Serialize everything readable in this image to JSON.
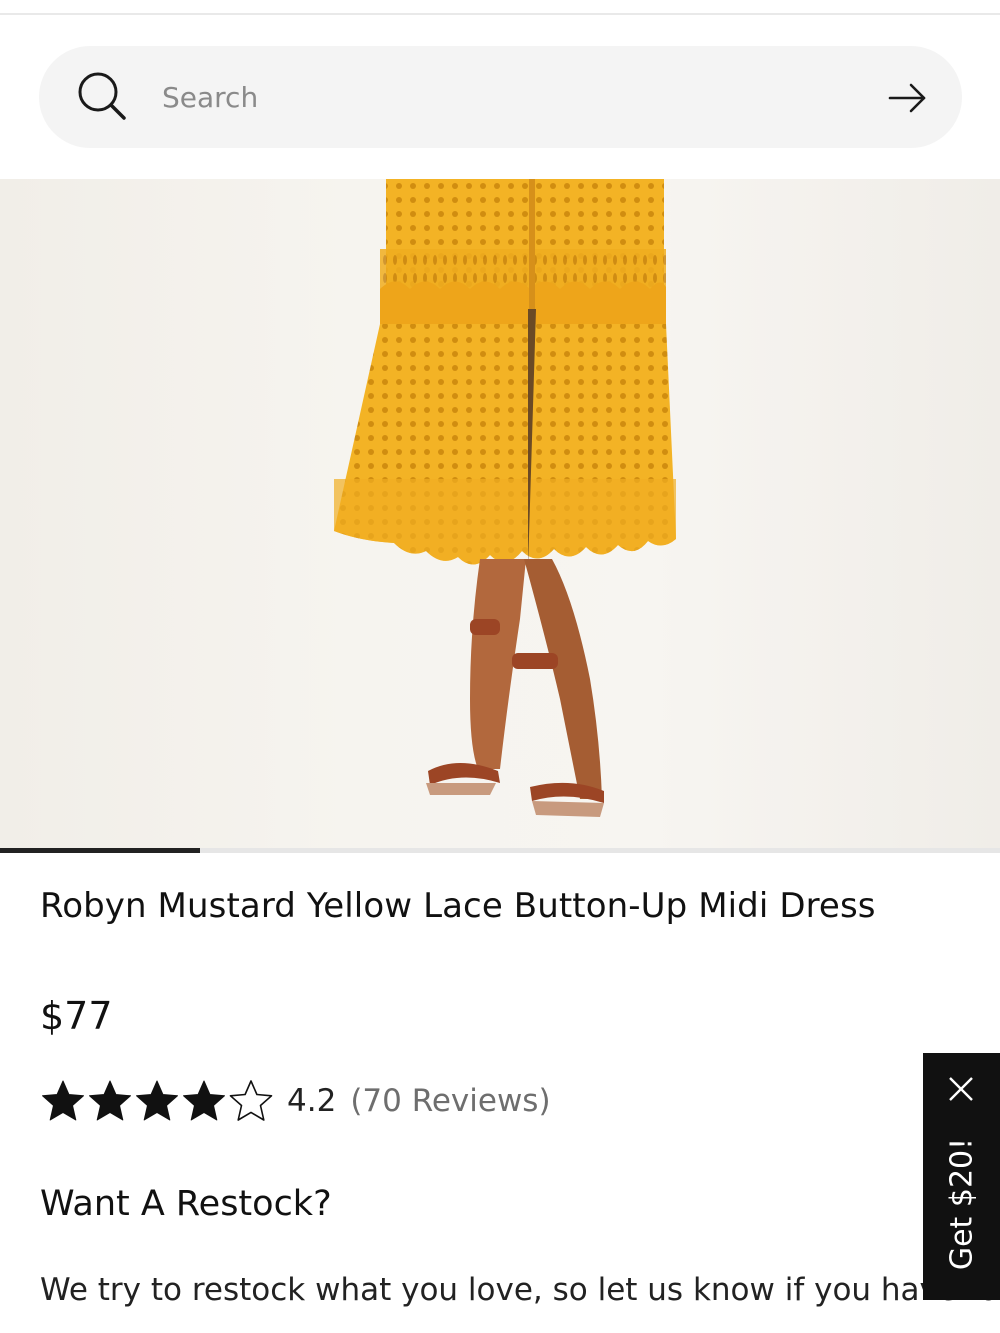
{
  "search": {
    "placeholder": "Search"
  },
  "icons": {
    "search": "search-icon",
    "submit": "arrow-right-icon",
    "close": "close-icon",
    "star_full": "star-filled-icon",
    "star_empty": "star-outline-icon"
  },
  "carousel": {
    "progress": 0.2
  },
  "product": {
    "title": "Robyn Mustard Yellow Lace Button-Up Midi Dress",
    "price": "$77",
    "rating": {
      "value": "4.2",
      "stars_filled": 4,
      "stars_total": 5,
      "reviews_label": "(70 Reviews)"
    },
    "image_colors": {
      "dress": "#f2b01f",
      "sandal": "#9c4525"
    }
  },
  "restock": {
    "heading": "Want A Restock?",
    "text": "We try to restock what you love, so let us know if you have to have it!"
  },
  "promo": {
    "label": "Get $20!"
  }
}
